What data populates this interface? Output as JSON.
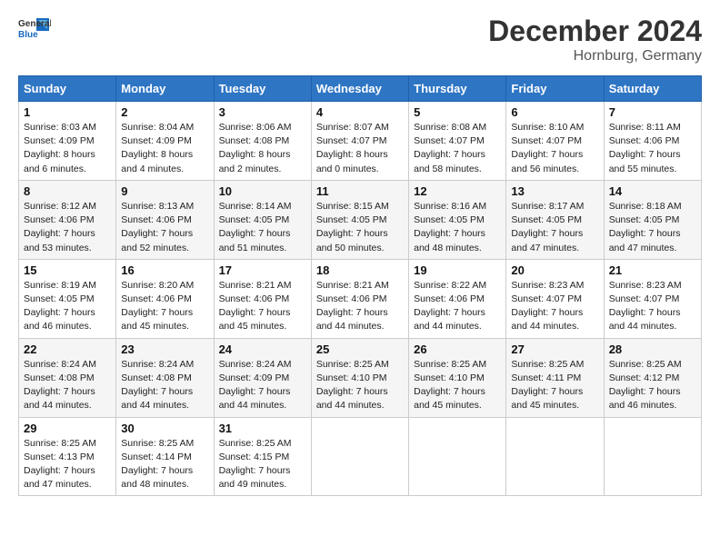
{
  "logo": {
    "general": "General",
    "blue": "Blue"
  },
  "title": "December 2024",
  "subtitle": "Hornburg, Germany",
  "days_header": [
    "Sunday",
    "Monday",
    "Tuesday",
    "Wednesday",
    "Thursday",
    "Friday",
    "Saturday"
  ],
  "weeks": [
    [
      {
        "day": "1",
        "sunrise": "8:03 AM",
        "sunset": "4:09 PM",
        "daylight": "8 hours and 6 minutes."
      },
      {
        "day": "2",
        "sunrise": "8:04 AM",
        "sunset": "4:09 PM",
        "daylight": "8 hours and 4 minutes."
      },
      {
        "day": "3",
        "sunrise": "8:06 AM",
        "sunset": "4:08 PM",
        "daylight": "8 hours and 2 minutes."
      },
      {
        "day": "4",
        "sunrise": "8:07 AM",
        "sunset": "4:07 PM",
        "daylight": "8 hours and 0 minutes."
      },
      {
        "day": "5",
        "sunrise": "8:08 AM",
        "sunset": "4:07 PM",
        "daylight": "7 hours and 58 minutes."
      },
      {
        "day": "6",
        "sunrise": "8:10 AM",
        "sunset": "4:07 PM",
        "daylight": "7 hours and 56 minutes."
      },
      {
        "day": "7",
        "sunrise": "8:11 AM",
        "sunset": "4:06 PM",
        "daylight": "7 hours and 55 minutes."
      }
    ],
    [
      {
        "day": "8",
        "sunrise": "8:12 AM",
        "sunset": "4:06 PM",
        "daylight": "7 hours and 53 minutes."
      },
      {
        "day": "9",
        "sunrise": "8:13 AM",
        "sunset": "4:06 PM",
        "daylight": "7 hours and 52 minutes."
      },
      {
        "day": "10",
        "sunrise": "8:14 AM",
        "sunset": "4:05 PM",
        "daylight": "7 hours and 51 minutes."
      },
      {
        "day": "11",
        "sunrise": "8:15 AM",
        "sunset": "4:05 PM",
        "daylight": "7 hours and 50 minutes."
      },
      {
        "day": "12",
        "sunrise": "8:16 AM",
        "sunset": "4:05 PM",
        "daylight": "7 hours and 48 minutes."
      },
      {
        "day": "13",
        "sunrise": "8:17 AM",
        "sunset": "4:05 PM",
        "daylight": "7 hours and 47 minutes."
      },
      {
        "day": "14",
        "sunrise": "8:18 AM",
        "sunset": "4:05 PM",
        "daylight": "7 hours and 47 minutes."
      }
    ],
    [
      {
        "day": "15",
        "sunrise": "8:19 AM",
        "sunset": "4:05 PM",
        "daylight": "7 hours and 46 minutes."
      },
      {
        "day": "16",
        "sunrise": "8:20 AM",
        "sunset": "4:06 PM",
        "daylight": "7 hours and 45 minutes."
      },
      {
        "day": "17",
        "sunrise": "8:21 AM",
        "sunset": "4:06 PM",
        "daylight": "7 hours and 45 minutes."
      },
      {
        "day": "18",
        "sunrise": "8:21 AM",
        "sunset": "4:06 PM",
        "daylight": "7 hours and 44 minutes."
      },
      {
        "day": "19",
        "sunrise": "8:22 AM",
        "sunset": "4:06 PM",
        "daylight": "7 hours and 44 minutes."
      },
      {
        "day": "20",
        "sunrise": "8:23 AM",
        "sunset": "4:07 PM",
        "daylight": "7 hours and 44 minutes."
      },
      {
        "day": "21",
        "sunrise": "8:23 AM",
        "sunset": "4:07 PM",
        "daylight": "7 hours and 44 minutes."
      }
    ],
    [
      {
        "day": "22",
        "sunrise": "8:24 AM",
        "sunset": "4:08 PM",
        "daylight": "7 hours and 44 minutes."
      },
      {
        "day": "23",
        "sunrise": "8:24 AM",
        "sunset": "4:08 PM",
        "daylight": "7 hours and 44 minutes."
      },
      {
        "day": "24",
        "sunrise": "8:24 AM",
        "sunset": "4:09 PM",
        "daylight": "7 hours and 44 minutes."
      },
      {
        "day": "25",
        "sunrise": "8:25 AM",
        "sunset": "4:10 PM",
        "daylight": "7 hours and 44 minutes."
      },
      {
        "day": "26",
        "sunrise": "8:25 AM",
        "sunset": "4:10 PM",
        "daylight": "7 hours and 45 minutes."
      },
      {
        "day": "27",
        "sunrise": "8:25 AM",
        "sunset": "4:11 PM",
        "daylight": "7 hours and 45 minutes."
      },
      {
        "day": "28",
        "sunrise": "8:25 AM",
        "sunset": "4:12 PM",
        "daylight": "7 hours and 46 minutes."
      }
    ],
    [
      {
        "day": "29",
        "sunrise": "8:25 AM",
        "sunset": "4:13 PM",
        "daylight": "7 hours and 47 minutes."
      },
      {
        "day": "30",
        "sunrise": "8:25 AM",
        "sunset": "4:14 PM",
        "daylight": "7 hours and 48 minutes."
      },
      {
        "day": "31",
        "sunrise": "8:25 AM",
        "sunset": "4:15 PM",
        "daylight": "7 hours and 49 minutes."
      },
      null,
      null,
      null,
      null
    ]
  ],
  "labels": {
    "sunrise": "Sunrise: ",
    "sunset": "Sunset: ",
    "daylight": "Daylight: "
  }
}
